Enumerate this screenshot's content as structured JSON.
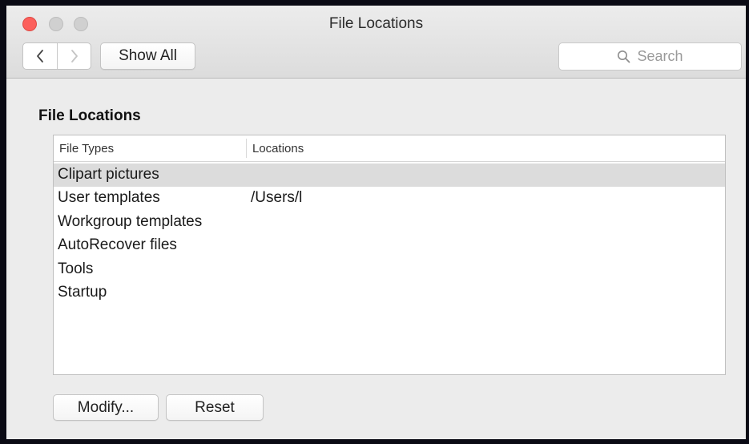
{
  "window": {
    "title": "File Locations"
  },
  "toolbar": {
    "back_icon": "chevron-left-icon",
    "forward_icon": "chevron-right-icon",
    "show_all_label": "Show All",
    "search_placeholder": "Search",
    "search_icon": "magnifier-icon"
  },
  "section": {
    "title": "File Locations"
  },
  "table": {
    "columns": [
      "File Types",
      "Locations"
    ],
    "rows": [
      {
        "type": "Clipart pictures",
        "location": ""
      },
      {
        "type": "User templates",
        "location": "/Users/l"
      },
      {
        "type": "Workgroup templates",
        "location": ""
      },
      {
        "type": "AutoRecover files",
        "location": ""
      },
      {
        "type": "Tools",
        "location": ""
      },
      {
        "type": "Startup",
        "location": ""
      }
    ],
    "selected_row": 0
  },
  "footer": {
    "modify_label": "Modify...",
    "reset_label": "Reset"
  },
  "colors": {
    "close": "#fc605c",
    "inactive_light": "#d0d0d0",
    "selection": "#dcdcdc",
    "window_bg": "#ececec"
  }
}
